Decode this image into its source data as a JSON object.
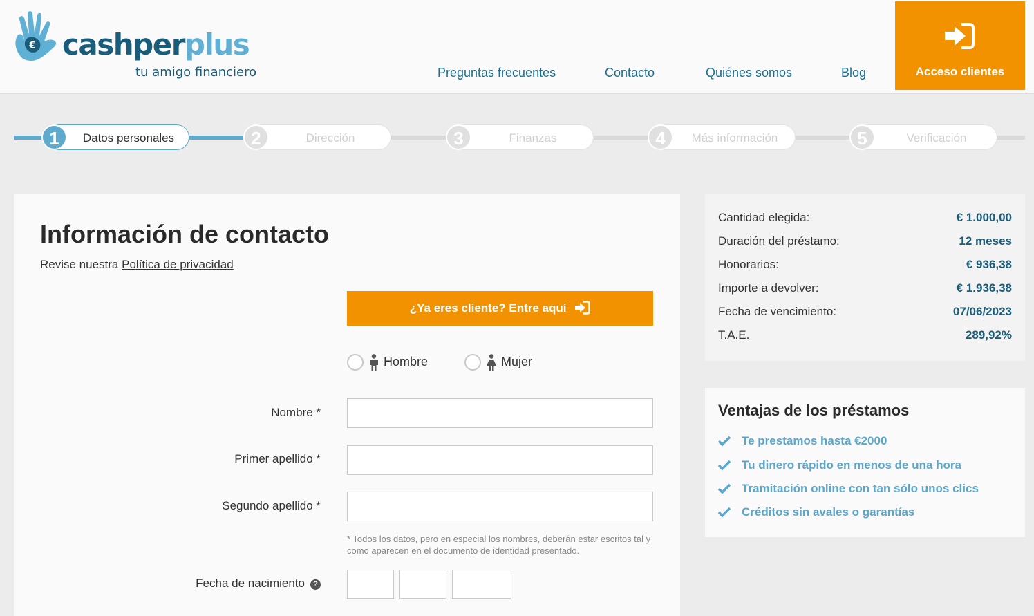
{
  "header": {
    "logo": {
      "name_part1": "cashper",
      "name_part2": "plus",
      "tagline": "tu amigo financiero"
    },
    "nav": [
      "Preguntas frecuentes",
      "Contacto",
      "Quiénes somos",
      "Blog"
    ],
    "access_button": "Acceso clientes"
  },
  "steps": [
    {
      "num": "1",
      "label": "Datos personales",
      "active": true
    },
    {
      "num": "2",
      "label": "Dirección",
      "active": false
    },
    {
      "num": "3",
      "label": "Finanzas",
      "active": false
    },
    {
      "num": "4",
      "label": "Más información",
      "active": false
    },
    {
      "num": "5",
      "label": "Verificación",
      "active": false
    }
  ],
  "form": {
    "title": "Información de contacto",
    "privacy_prefix": "Revise nuestra ",
    "privacy_link": "Política de privacidad",
    "client_button": "¿Ya eres cliente? Entre aquí",
    "gender_options": [
      "Hombre",
      "Mujer"
    ],
    "fields": {
      "nombre": {
        "label": "Nombre *",
        "value": ""
      },
      "primer_apellido": {
        "label": "Primer apellido *",
        "value": ""
      },
      "segundo_apellido": {
        "label": "Segundo apellido *",
        "value": ""
      }
    },
    "note": "* Todos los datos, pero en especial los nombres, deberán estar escritos tal y como aparecen en el documento de identidad presentado.",
    "birthdate_label": "Fecha de nacimiento",
    "help_icon": "?"
  },
  "summary": [
    {
      "label": "Cantidad elegida:",
      "value": "€  1.000,00"
    },
    {
      "label": "Duración del préstamo:",
      "value": "12 meses"
    },
    {
      "label": "Honorarios:",
      "value": "€  936,38"
    },
    {
      "label": "Importe a devolver:",
      "value": "€  1.936,38"
    },
    {
      "label": "Fecha de vencimiento:",
      "value": "07/06/2023"
    },
    {
      "label": "T.A.E.",
      "value": "289,92%"
    }
  ],
  "advantages": {
    "title": "Ventajas de los préstamos",
    "items": [
      "Te prestamos hasta €2000",
      "Tu dinero rápido en menos de una hora",
      "Tramitación online con tan sólo unos clics",
      "Créditos sin avales o garantías"
    ]
  },
  "colors": {
    "accent_orange": "#f39200",
    "brand_blue": "#1a5d7a",
    "light_blue": "#5fa9cc"
  },
  "icons": [
    "hand-euro-logo-icon",
    "sign-in-icon",
    "male-icon",
    "female-icon",
    "help-icon",
    "check-icon"
  ]
}
